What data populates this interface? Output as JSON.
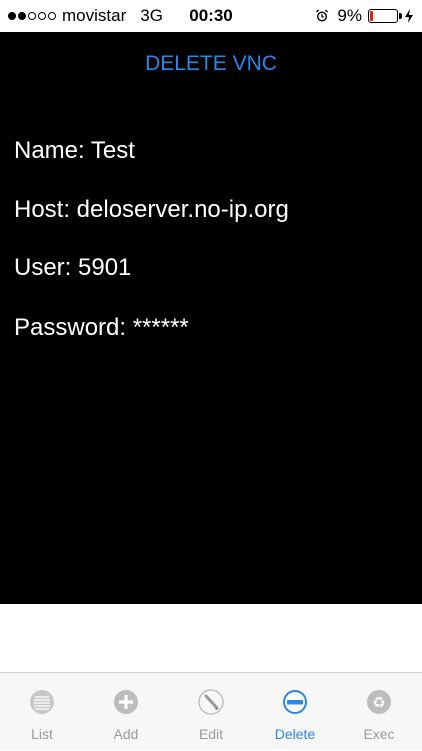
{
  "status_bar": {
    "carrier": "movistar",
    "network": "3G",
    "time": "00:30",
    "battery_percent": "9%",
    "signal_bars_filled": 2,
    "signal_bars_total": 5,
    "battery_level": 0.09,
    "battery_color": "#e2241a"
  },
  "screen": {
    "title": "DELETE VNC",
    "title_color": "#2b86e6",
    "fields": {
      "name": "Name: Test",
      "host": "Host: deloserver.no-ip.org",
      "user": "User: 5901",
      "password": "Password: ******"
    }
  },
  "tabs": [
    {
      "label": "List",
      "icon": "list-icon",
      "active": false
    },
    {
      "label": "Add",
      "icon": "plus-icon",
      "active": false
    },
    {
      "label": "Edit",
      "icon": "pencil-icon",
      "active": false
    },
    {
      "label": "Delete",
      "icon": "minus-icon",
      "active": true
    },
    {
      "label": "Exec",
      "icon": "recycle-icon",
      "active": false
    }
  ],
  "colors": {
    "accent": "#2b86e6",
    "panel_background": "#000000",
    "tab_inactive": "#9a9a9a"
  }
}
